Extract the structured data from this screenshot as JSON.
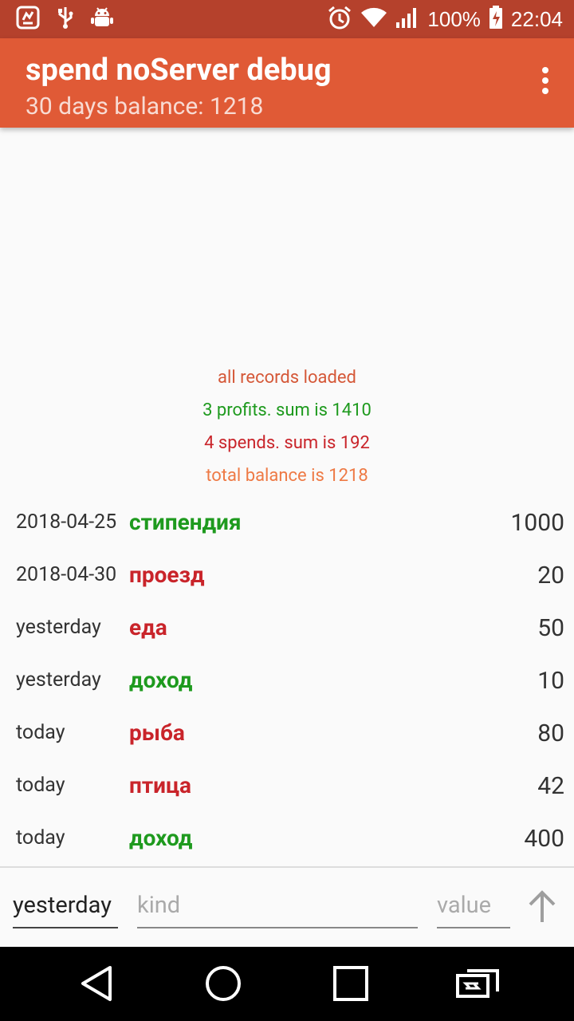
{
  "status_bar": {
    "battery": "100%",
    "time": "22:04",
    "icons": [
      "app-notification-icon",
      "usb-icon",
      "android-debug-icon",
      "alarm-icon",
      "wifi-icon",
      "signal-icon",
      "battery-charging-icon"
    ]
  },
  "app_bar": {
    "title": "spend noServer debug",
    "subtitle": "30 days balance: 1218",
    "menu_icon": "overflow-menu-icon"
  },
  "summary": {
    "loaded": "all records loaded",
    "profits": "3 profits. sum is 1410",
    "spends": "4 spends. sum is 192",
    "total": "total balance is 1218"
  },
  "records": [
    {
      "date": "2018-04-25",
      "kind": "стипендия",
      "value": "1000",
      "type": "profit"
    },
    {
      "date": "2018-04-30",
      "kind": "проезд",
      "value": "20",
      "type": "spend"
    },
    {
      "date": "yesterday",
      "kind": "еда",
      "value": "50",
      "type": "spend"
    },
    {
      "date": "yesterday",
      "kind": "доход",
      "value": "10",
      "type": "profit"
    },
    {
      "date": "today",
      "kind": "рыба",
      "value": "80",
      "type": "spend"
    },
    {
      "date": "today",
      "kind": "птица",
      "value": "42",
      "type": "spend"
    },
    {
      "date": "today",
      "kind": "доход",
      "value": "400",
      "type": "profit"
    }
  ],
  "input": {
    "date_value": "yesterday",
    "kind_placeholder": "kind",
    "value_placeholder": "value"
  },
  "colors": {
    "status_bar": "#b5412c",
    "app_bar": "#e05a36",
    "profit": "#1e9a1e",
    "spend": "#c9242a",
    "total": "#ee7a45"
  }
}
